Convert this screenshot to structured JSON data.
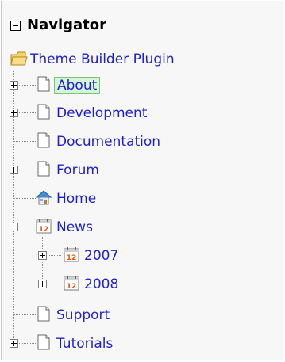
{
  "navigator": {
    "title": "Navigator",
    "root": {
      "label": "Theme Builder Plugin",
      "icon": "folder-icon"
    },
    "items": [
      {
        "label": "About",
        "icon": "page-icon",
        "expander": "plus",
        "selected": true
      },
      {
        "label": "Development",
        "icon": "page-icon",
        "expander": "plus"
      },
      {
        "label": "Documentation",
        "icon": "page-icon",
        "expander": "none"
      },
      {
        "label": "Forum",
        "icon": "page-icon",
        "expander": "plus"
      },
      {
        "label": "Home",
        "icon": "home-icon",
        "expander": "none"
      },
      {
        "label": "News",
        "icon": "calendar-icon",
        "expander": "minus",
        "calendar_day": "12",
        "children": [
          {
            "label": "2007",
            "icon": "calendar-icon",
            "expander": "plus",
            "calendar_day": "12"
          },
          {
            "label": "2008",
            "icon": "calendar-icon",
            "expander": "plus",
            "calendar_day": "12"
          }
        ]
      },
      {
        "label": "Support",
        "icon": "page-icon",
        "expander": "none"
      },
      {
        "label": "Tutorials",
        "icon": "page-icon",
        "expander": "plus"
      }
    ]
  },
  "colors": {
    "link": "#1f1fd0",
    "selected_bg": "#d5f5d5",
    "selected_border": "#7ac37a"
  }
}
